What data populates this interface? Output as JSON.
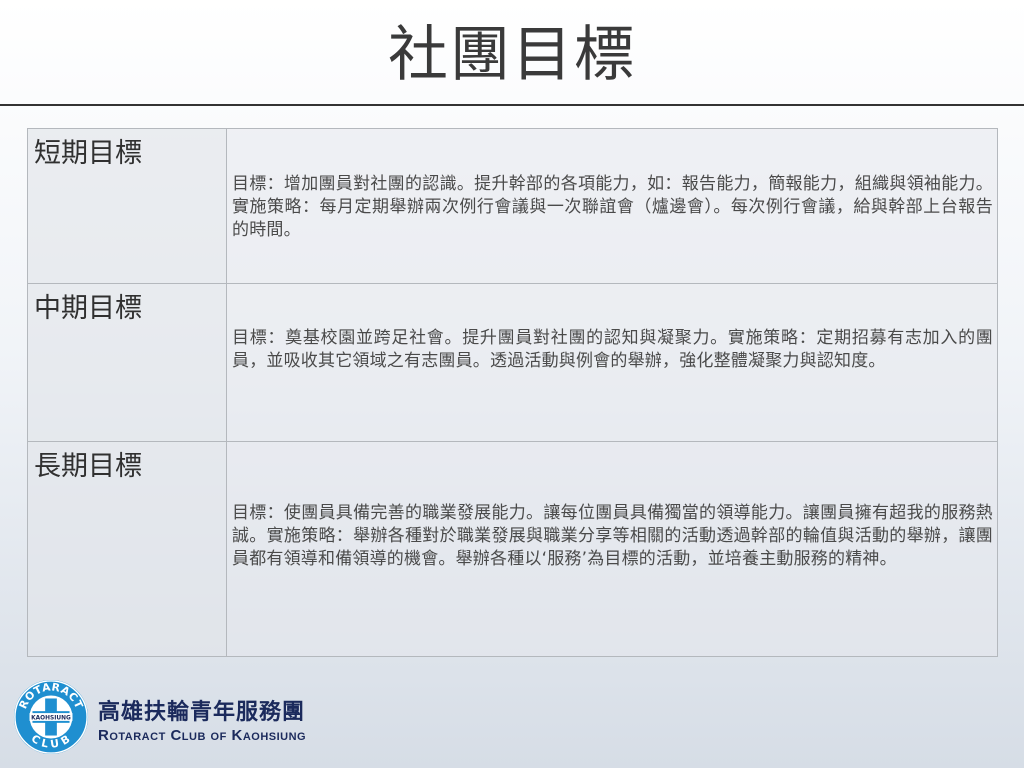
{
  "slide": {
    "title": "社團目標"
  },
  "goals": [
    {
      "label": "短期目標",
      "text": "目標：增加團員對社團的認識。提升幹部的各項能力，如：報告能力，簡報能力，組織與領袖能力。實施策略：每月定期舉辦兩次例行會議與一次聯誼會（爐邊會）。每次例行會議，給與幹部上台報告的時間。"
    },
    {
      "label": "中期目標",
      "text": "目標：奠基校園並跨足社會。提升團員對社團的認知與凝聚力。實施策略：定期招募有志加入的團員，並吸收其它領域之有志團員。透過活動與例會的舉辦，強化整體凝聚力與認知度。"
    },
    {
      "label": "長期目標",
      "text": "目標：使團員具備完善的職業發展能力。讓每位團員具備獨當的領導能力。讓團員擁有超我的服務熱誠。實施策略：舉辦各種對於職業發展與職業分享等相關的活動透過幹部的輪值與活動的舉辦，讓團員都有領導和備領導的機會。舉辦各種以‘服務’為目標的活動，並培養主動服務的精神。"
    }
  ],
  "footer": {
    "logo_top_text": "ROTARACT",
    "logo_middle_text": "KAOHSIUNG",
    "logo_bottom_text": "CLUB",
    "club_name_zh": "高雄扶輪青年服務團",
    "club_name_en": "Rotaract Club of Kaohsiung",
    "logo_colors": {
      "ring": "#1f8fd0",
      "inner": "#ffffff",
      "text": "#ffffff",
      "dark": "#1b2a5c"
    }
  }
}
